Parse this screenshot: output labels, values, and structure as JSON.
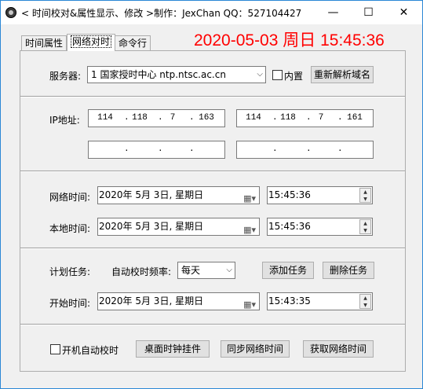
{
  "window": {
    "title": "< 时间校对&属性显示、修改 >制作：JexChan  QQ：527104427",
    "min_glyph": "—",
    "max_glyph": "☐",
    "close_glyph": "✕"
  },
  "clock": "2020-05-03 周日 15:45:36",
  "tabs": [
    {
      "label": "时间属性"
    },
    {
      "label": "网络对时"
    },
    {
      "label": "命令行"
    }
  ],
  "server": {
    "label": "服务器:",
    "selected": "1  国家授时中心  ntp.ntsc.ac.cn",
    "builtin_label": "内置",
    "reresolve_button": "重新解析域名"
  },
  "ip": {
    "label": "IP地址:",
    "boxes": [
      {
        "octets": [
          "114",
          "118",
          "7",
          "163"
        ]
      },
      {
        "octets": [
          "114",
          "118",
          "7",
          "161"
        ]
      },
      {
        "octets": [
          "",
          "",
          "",
          ""
        ]
      },
      {
        "octets": [
          "",
          "",
          "",
          ""
        ]
      }
    ]
  },
  "network_time": {
    "label": "网络时间:",
    "date": "2020年  5月  3日,  星期日",
    "time": "15:45:36"
  },
  "local_time": {
    "label": "本地时间:",
    "date": "2020年  5月  3日,  星期日",
    "time": "15:45:36"
  },
  "schedule": {
    "label": "计划任务:",
    "freq_label": "自动校时频率:",
    "freq_value": "每天",
    "add_button": "添加任务",
    "delete_button": "删除任务"
  },
  "start_time": {
    "label": "开始时间:",
    "date": "2020年  5月  3日,  星期日",
    "time": "15:43:35"
  },
  "footer": {
    "autostart_label": "开机自动校时",
    "desktop_clock_button": "桌面时钟挂件",
    "sync_button": "同步网络时间",
    "get_button": "获取网络时间"
  },
  "icons": {
    "dropdown": "chevron-down-icon",
    "calendar": "calendar-icon",
    "spin": "spin-updown-icon"
  },
  "colors": {
    "clock": "#ff0000",
    "title_border": "#2b87d5"
  }
}
